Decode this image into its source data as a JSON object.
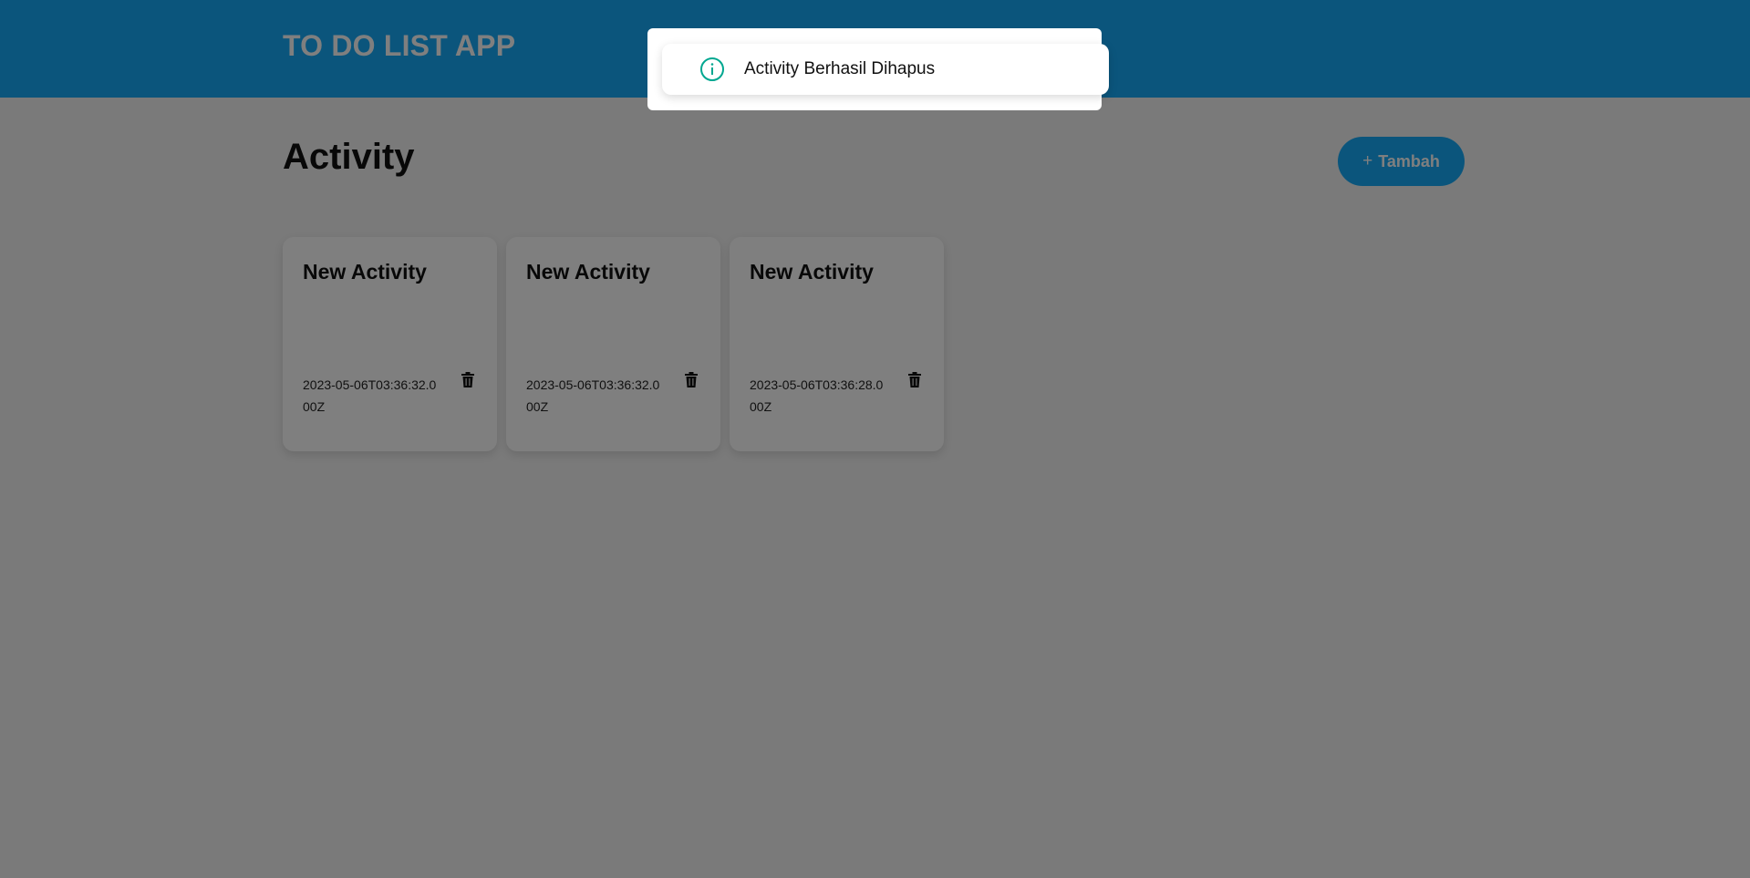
{
  "header": {
    "title": "TO DO LIST APP"
  },
  "page": {
    "title": "Activity",
    "add_button": {
      "icon": "+",
      "label": "Tambah"
    }
  },
  "activities": [
    {
      "title": "New Activity",
      "date": "2023-05-06T03:36:32.000Z"
    },
    {
      "title": "New Activity",
      "date": "2023-05-06T03:36:32.000Z"
    },
    {
      "title": "New Activity",
      "date": "2023-05-06T03:36:28.000Z"
    }
  ],
  "toast": {
    "message": "Activity Berhasil Dihapus",
    "icon": "info-icon"
  },
  "colors": {
    "brand": "#16abf8",
    "info": "#00a790",
    "overlay": "rgba(0,0,0,0.5)"
  }
}
